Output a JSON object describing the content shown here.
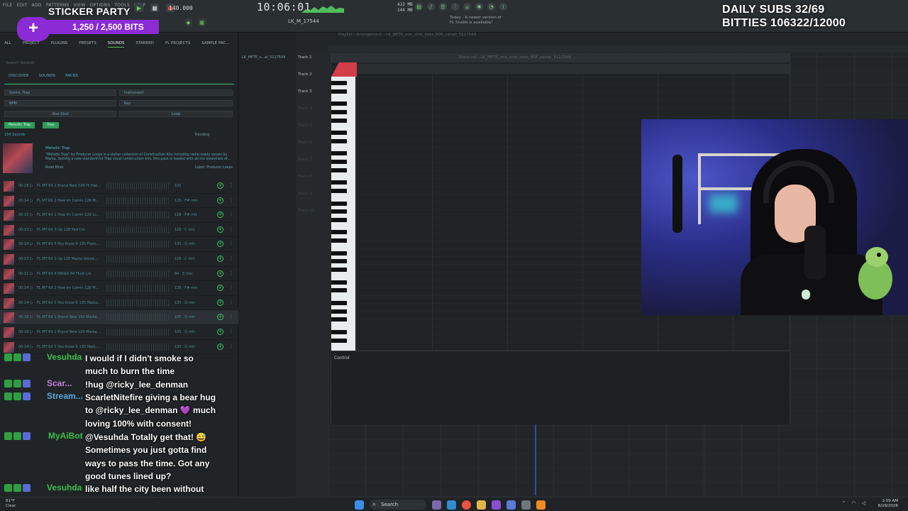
{
  "fl_studio": {
    "menu": [
      "FILE",
      "EDIT",
      "ADD",
      "PATTERNS",
      "VIEW",
      "OPTIONS",
      "TOOLS",
      "HELP"
    ],
    "tempo": "140.000",
    "time": "10:06:01",
    "cpu": [
      "422 MB",
      "144 MB"
    ],
    "update_notice": [
      "Today - A newer version of",
      "FL Studio is available!"
    ],
    "pattern_name": "LK_M_17544",
    "midstrip_label": "LK_MFTK_o...el_5117544",
    "playlist_title": "Playlist - Arrangement › LK_MFTK_one_shot_bass_808_camel_5117544",
    "piano_roll_title": "Piano roll - LK_MFTK_one_shot_bass_808_camel_5117544",
    "control_label": "Control",
    "tracks": [
      "Track 1",
      "Track 2",
      "Track 3",
      "Track 4",
      "Track 5",
      "Track 6",
      "Track 7",
      "Track 8",
      "Track 9",
      "Track 10"
    ]
  },
  "browser": {
    "tabs": [
      "ALL",
      "PROJECT",
      "PLUGINS",
      "PRESETS",
      "SOUNDS",
      "STARRED",
      "FL PROJECTS",
      "SAMPLE PAC..."
    ],
    "active_tab": "SOUNDS",
    "search_placeholder": "Search Sounds",
    "subtabs": [
      "DISCOVER",
      "SOUNDS",
      "PACKS"
    ],
    "filters": {
      "genre": "Genre: Trap",
      "instrument": "Instrument",
      "bpm": "BPM",
      "key": "Key",
      "oneshot": "One-Shot",
      "loop": "Loop"
    },
    "chips": [
      "Melodic Trap",
      "Trap"
    ],
    "result_count": "154 Sounds",
    "sort": "Trending",
    "pack": {
      "title": "Melodic Trap",
      "desc": "\"Melodic Trap\" by Producer Loops is a stellar collection of Construction Kits including radio-ready vocals by Marka. Setting a new standard for Trap vocal construction kits, this pack is loaded with all the essentials of...",
      "more": "Read More",
      "by": "Label: Producer Loops"
    },
    "samples": [
      {
        "time": "00:18",
        "name": "FL MT Kit 1 Brand New 105 Hi Hat...",
        "meta": "105"
      },
      {
        "time": "00:14",
        "name": "FL MT Kit 2 How Im Comin 128 M...",
        "meta": "128 · F# min"
      },
      {
        "time": "00:15",
        "name": "FL MT Kit 2 How Im Comin 128 Lc...",
        "meta": "128 · F# min"
      },
      {
        "time": "00:13",
        "name": "FL MT Kit 3 Up 128 Pad Cm",
        "meta": "128 · C min"
      },
      {
        "time": "00:14",
        "name": "FL MT Kit 5 You Know It 135 Flute...",
        "meta": "135 · G min"
      },
      {
        "time": "00:13",
        "name": "FL MT Kit 3 Up 128 Marka Vocals...",
        "meta": "128 · C min"
      },
      {
        "time": "00:11",
        "name": "FL MT Kit 4 WRGD 84 Flute Lm",
        "meta": "84 · E min"
      },
      {
        "time": "00:14",
        "name": "FL MT Kit 2 How Im Comin 128 M...",
        "meta": "128 · F# min"
      },
      {
        "time": "00:14",
        "name": "FL MT Kit 5 You Know It 135 Marka...",
        "meta": "135 · G min"
      },
      {
        "time": "00:18",
        "name": "FL MT Kit 1 Brand New 105 Marka...",
        "meta": "105 · G min"
      },
      {
        "time": "00:18",
        "name": "FL MT Kit 1 Brand New 105 Marka...",
        "meta": "105 · G min"
      },
      {
        "time": "00:14",
        "name": "FL MT Kit 5 You Know It 135 Mark...",
        "meta": "135 · G min"
      }
    ]
  },
  "overlay": {
    "sticker_title": "STICKER PARTY",
    "sticker_progress": "1,250 / 2,500 BITS",
    "sticker_progress_value": 0.5,
    "subs_line1": "DAILY SUBS 32/69",
    "subs_line2": "BITTIES 106322/12000"
  },
  "chat": [
    {
      "user": "Vesuhda",
      "color": "#3fbf4a",
      "text": "I would if I didn't smoke so much to burn the time"
    },
    {
      "user": "Scar...",
      "color": "#c77de0",
      "text": "!hug @ricky_lee_denman"
    },
    {
      "user": "Stream...",
      "color": "#5aa7e0",
      "text": "ScarletNitefire giving a bear hug to @ricky_lee_denman 💜 much loving 100% with consent!"
    },
    {
      "user": "MyAiBot",
      "color": "#3fbf4a",
      "text": "@Vesuhda Totally get that! 😅 Sometimes you just gotta find ways to pass the time. Got any good tunes lined up?"
    },
    {
      "user": "Vesuhda",
      "color": "#3fbf4a",
      "text": "like half the city been without power for hours 😌"
    }
  ],
  "taskbar": {
    "weather": [
      "81°F",
      "Clear"
    ],
    "search": "Search",
    "time": "2:59 AM",
    "date": "8/29/2026"
  },
  "colors": {
    "accent_green": "#3bbf6a",
    "sticker_purple": "#8b2bd6",
    "piano_red": "#d23d4a"
  }
}
